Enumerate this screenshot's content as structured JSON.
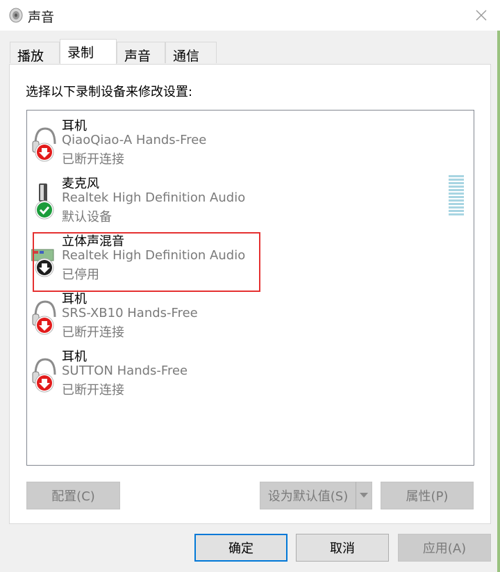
{
  "window": {
    "title": "声音"
  },
  "tabs": [
    {
      "label": "播放"
    },
    {
      "label": "录制"
    },
    {
      "label": "声音"
    },
    {
      "label": "通信"
    }
  ],
  "active_tab": "录制",
  "instruction": "选择以下录制设备来修改设置:",
  "devices": [
    {
      "name": "耳机",
      "sub": "QiaoQiao-A Hands-Free",
      "status": "已断开连接",
      "icon": "headset-disconnected-icon"
    },
    {
      "name": "麦克风",
      "sub": "Realtek High Definition Audio",
      "status": "默认设备",
      "icon": "microphone-default-icon"
    },
    {
      "name": "立体声混音",
      "sub": "Realtek High Definition Audio",
      "status": "已停用",
      "icon": "stereo-mix-disabled-icon"
    },
    {
      "name": "耳机",
      "sub": "SRS-XB10 Hands-Free",
      "status": "已断开连接",
      "icon": "headset-disconnected-icon"
    },
    {
      "name": "耳机",
      "sub": "SUTTON Hands-Free",
      "status": "已断开连接",
      "icon": "headset-disconnected-icon"
    }
  ],
  "buttons": {
    "configure": "配置(C)",
    "set_default": "设为默认值(S)",
    "properties": "属性(P)",
    "ok": "确定",
    "cancel": "取消",
    "apply": "应用(A)"
  },
  "colors": {
    "highlight": "#e53030",
    "primary_border": "#0078d7",
    "status_green": "#1a9c3a",
    "status_red": "#e21b1b"
  }
}
